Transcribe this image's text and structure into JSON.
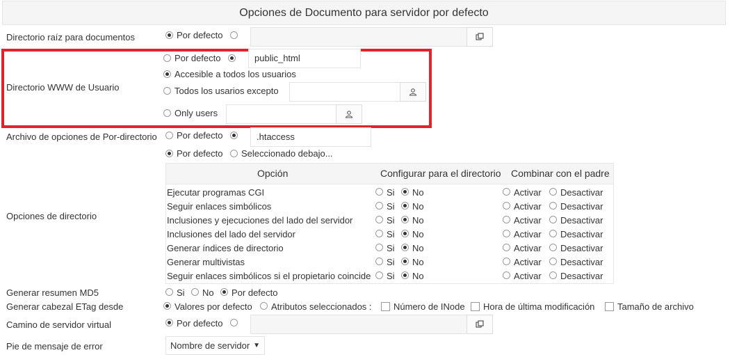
{
  "title": "Opciones de Documento para servidor por defecto",
  "docroot": {
    "label": "Directorio raíz para documentos",
    "default_option": "Por defecto"
  },
  "userdir": {
    "label": "Directorio WWW de Usuario",
    "default_option": "Por defecto",
    "value": "public_html",
    "all_users": "Accesible a todos los usuarios",
    "all_except": "Todos los usarios excepto",
    "only_users": "Only users"
  },
  "access_file": {
    "label": "Archivo de opciones de Por-directorio",
    "default_option": "Por defecto",
    "value": ".htaccess"
  },
  "dir_options": {
    "label": "Opciones de directorio",
    "default_option": "Por defecto",
    "selected_below": "Seleccionado debajo...",
    "headers": {
      "option": "Opción",
      "configure": "Configurar para el directorio",
      "merge": "Combinar con el padre"
    },
    "yes": "Si",
    "no": "No",
    "activate": "Activar",
    "deactivate": "Desactivar",
    "rows": [
      {
        "name": "Ejecutar programas CGI",
        "value": "No"
      },
      {
        "name": "Seguir enlaces simbólicos",
        "value": "No"
      },
      {
        "name": "Inclusiones y ejecuciones del lado del servidor",
        "value": "No"
      },
      {
        "name": "Inclusiones del lado del servidor",
        "value": "No"
      },
      {
        "name": "Generar índices de directorio",
        "value": "No"
      },
      {
        "name": "Generar multivistas",
        "value": "No"
      },
      {
        "name": "Seguir enlaces simbólicos si el propietario coincide",
        "value": "No"
      }
    ]
  },
  "md5": {
    "label": "Generar resumen MD5",
    "yes": "Si",
    "no": "No",
    "default_option": "Por defecto"
  },
  "etag": {
    "label": "Generar cabezal ETag desde",
    "default_values": "Valores por defecto",
    "selected_attrs": "Atributos seleccionados :",
    "inode": "Número de INode",
    "mtime": "Hora de última modificación",
    "size": "Tamaño de archivo"
  },
  "vpath": {
    "label": "Camino de servidor virtual",
    "default_option": "Por defecto"
  },
  "error_footer": {
    "label": "Pie de mensaje de error",
    "selected": "Nombre de servidor"
  }
}
